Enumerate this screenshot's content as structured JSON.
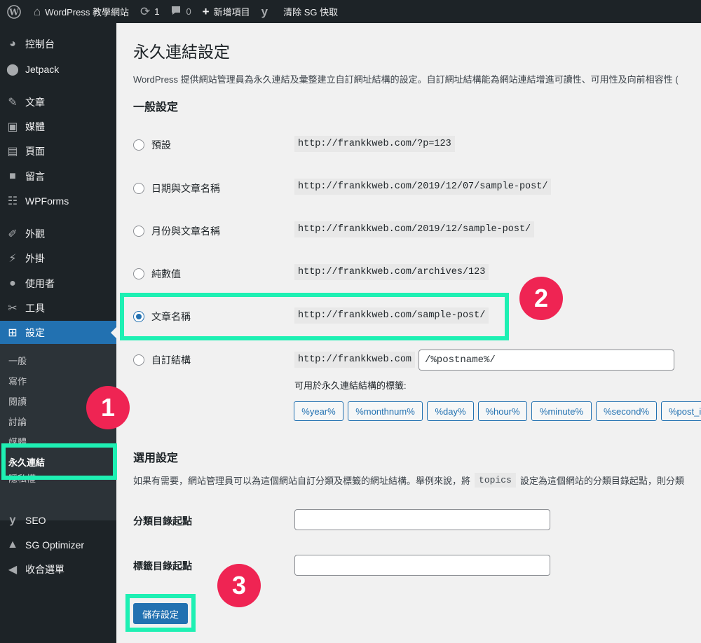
{
  "admin_bar": {
    "site_name": "WordPress 教學網站",
    "updates_count": "1",
    "comments_count": "0",
    "new_label": "新增項目",
    "purge_label": "清除 SG 快取"
  },
  "sidebar": {
    "items": [
      {
        "label": "控制台",
        "icon": "dashboard-icon"
      },
      {
        "label": "Jetpack",
        "icon": "jetpack-icon"
      },
      {
        "label": "文章",
        "icon": "pin-icon"
      },
      {
        "label": "媒體",
        "icon": "media-icon"
      },
      {
        "label": "頁面",
        "icon": "page-icon"
      },
      {
        "label": "留言",
        "icon": "comment-icon"
      },
      {
        "label": "WPForms",
        "icon": "forms-icon"
      },
      {
        "label": "外觀",
        "icon": "brush-icon"
      },
      {
        "label": "外掛",
        "icon": "plugin-icon"
      },
      {
        "label": "使用者",
        "icon": "user-icon"
      },
      {
        "label": "工具",
        "icon": "wrench-icon"
      },
      {
        "label": "設定",
        "icon": "settings-icon"
      },
      {
        "label": "SEO",
        "icon": "yoast-icon"
      },
      {
        "label": "SG Optimizer",
        "icon": "sg-icon"
      },
      {
        "label": "收合選單",
        "icon": "collapse-icon"
      }
    ],
    "submenu": [
      "一般",
      "寫作",
      "閱讀",
      "討論",
      "媒體",
      "永久連結",
      "隱私權"
    ]
  },
  "main": {
    "title": "永久連結設定",
    "intro": "WordPress 提供網站管理員為永久連結及彙整建立自訂網址結構的設定。自訂網址結構能為網站連結增進可讀性、可用性及向前相容性 (",
    "general_heading": "一般設定",
    "options": [
      {
        "label": "預設",
        "url": "http://frankkweb.com/?p=123",
        "checked": false
      },
      {
        "label": "日期與文章名稱",
        "url": "http://frankkweb.com/2019/12/07/sample-post/",
        "checked": false
      },
      {
        "label": "月份與文章名稱",
        "url": "http://frankkweb.com/2019/12/sample-post/",
        "checked": false
      },
      {
        "label": "純數值",
        "url": "http://frankkweb.com/archives/123",
        "checked": false
      },
      {
        "label": "文章名稱",
        "url": "http://frankkweb.com/sample-post/",
        "checked": true
      },
      {
        "label": "自訂結構",
        "url": "http://frankkweb.com",
        "checked": false
      }
    ],
    "custom_structure_value": "/%postname%/",
    "tags_label": "可用於永久連結結構的標籤:",
    "tags": [
      "%year%",
      "%monthnum%",
      "%day%",
      "%hour%",
      "%minute%",
      "%second%",
      "%post_i"
    ],
    "optional_heading": "選用設定",
    "optional_desc_before": "如果有需要，網站管理員可以為這個網站自訂分類及標籤的網址結構。舉例來說，將",
    "optional_desc_code": "topics",
    "optional_desc_after": "設定為這個網站的分類目錄起點，則分類",
    "category_base_label": "分類目錄起點",
    "category_base_value": "",
    "tag_base_label": "標籤目錄起點",
    "tag_base_value": "",
    "save_label": "儲存設定"
  },
  "annotations": [
    "1",
    "2",
    "3"
  ],
  "colors": {
    "admin_dark": "#1d2327",
    "wp_blue": "#2271b1",
    "highlight": "#1ef0b3",
    "marker": "#ef2453"
  }
}
